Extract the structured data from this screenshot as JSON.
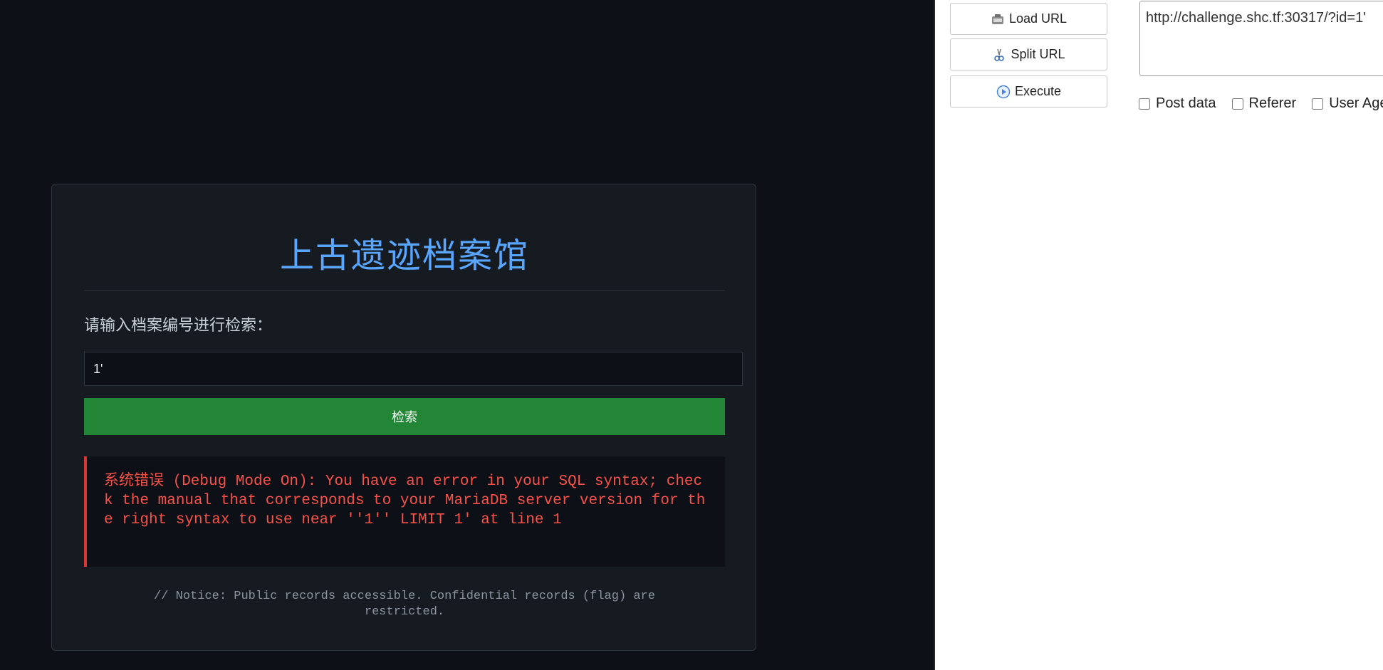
{
  "archive": {
    "title": "上古遗迹档案馆",
    "prompt": "请输入档案编号进行检索：",
    "input_value": "1'",
    "search_label": "检索",
    "error_message": "系统错误 (Debug Mode On): You have an error in your SQL syntax; check the manual that corresponds to your MariaDB server version for the right syntax to use near ''1'' LIMIT 1' at line 1",
    "notice": "// Notice: Public records accessible. Confidential records (flag) are restricted."
  },
  "tools": {
    "load_url": "Load URL",
    "split_url": "Split URL",
    "execute": "Execute",
    "url_value": "http://challenge.shc.tf:30317/?id=1'",
    "checkboxes": [
      "Post data",
      "Referer",
      "User Agent"
    ]
  },
  "colors": {
    "accent": "#58a6ff",
    "button": "#238636",
    "error": "#f85149",
    "background": "#0d1117"
  },
  "icons": [
    "load-url-icon",
    "scissors-icon",
    "play-icon"
  ]
}
